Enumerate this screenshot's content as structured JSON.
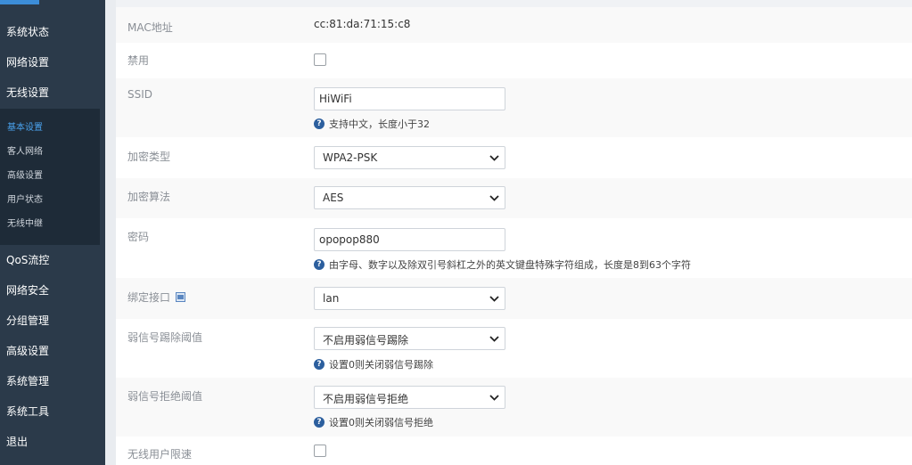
{
  "sidebar": {
    "items": [
      {
        "label": "系统状态"
      },
      {
        "label": "网络设置"
      },
      {
        "label": "无线设置"
      },
      {
        "label": "QoS流控"
      },
      {
        "label": "网络安全"
      },
      {
        "label": "分组管理"
      },
      {
        "label": "高级设置"
      },
      {
        "label": "系统管理"
      },
      {
        "label": "系统工具"
      },
      {
        "label": "退出"
      }
    ],
    "submenu": [
      {
        "label": "基本设置",
        "active": true
      },
      {
        "label": "客人网络"
      },
      {
        "label": "高级设置"
      },
      {
        "label": "用户状态"
      },
      {
        "label": "无线中继"
      }
    ]
  },
  "form": {
    "mac": {
      "label": "MAC地址",
      "value": "cc:81:da:71:15:c8"
    },
    "disable": {
      "label": "禁用",
      "checked": false
    },
    "ssid": {
      "label": "SSID",
      "value": "HiWiFi",
      "help": "支持中文，长度小于32"
    },
    "encryption_type": {
      "label": "加密类型",
      "value": "WPA2-PSK"
    },
    "encryption_algo": {
      "label": "加密算法",
      "value": "AES"
    },
    "password": {
      "label": "密码",
      "value": "opopop880",
      "help": "由字母、数字以及除双引号斜杠之外的英文键盘特殊字符组成，长度是8到63个字符"
    },
    "bind_interface": {
      "label": "绑定接口",
      "value": "lan"
    },
    "weak_kick": {
      "label": "弱信号踢除阈值",
      "value": "不启用弱信号踢除",
      "help": "设置0则关闭弱信号踢除"
    },
    "weak_reject": {
      "label": "弱信号拒绝阈值",
      "value": "不启用弱信号拒绝",
      "help": "设置0则关闭弱信号拒绝"
    },
    "rate_limit": {
      "label": "无线用户限速",
      "checked": false
    }
  },
  "icons": {
    "help": "question-circle-icon",
    "select": "chevron-down-icon",
    "interface": "network-port-icon"
  },
  "colors": {
    "sidebar_bg": "#2b3a4a",
    "submenu_bg": "#1e2b38",
    "active_link": "#4aa3ef",
    "help_icon": "#2c5f9e"
  }
}
